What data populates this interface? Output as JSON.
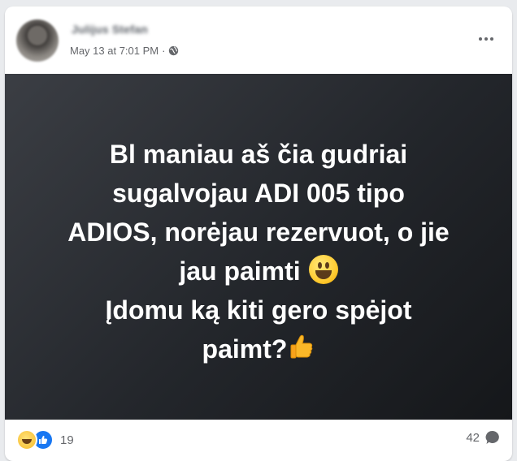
{
  "post": {
    "author": "Julijus Stefan",
    "timestamp": "May 13 at 7:01 PM",
    "separator": "·",
    "privacy_icon": "globe-icon",
    "menu_icon": "more-horizontal-icon",
    "background": {
      "gradient_start": "#3b3e44",
      "gradient_end": "#15171a"
    },
    "text_lines": [
      "Bl maniau aš čia gudriai",
      "sugalvojau ADI 005 tipo",
      "ADIOS, norėjau rezervuot, o jie",
      "jau paimti",
      "Įdomu ką kiti gero spėjot",
      "paimt?"
    ],
    "emoji_after_line_4": "grinning-face-emoji",
    "emoji_after_line_6": "thumbs-up-emoji"
  },
  "footer": {
    "reaction_icons": [
      "haha-reaction-icon",
      "like-reaction-icon"
    ],
    "reaction_count": "19",
    "comment_count": "42",
    "comment_icon": "comment-bubble-icon"
  },
  "colors": {
    "text_secondary": "#65676b",
    "like_blue": "#1877f2",
    "card_bg": "#ffffff",
    "page_bg": "#e9ebee"
  }
}
